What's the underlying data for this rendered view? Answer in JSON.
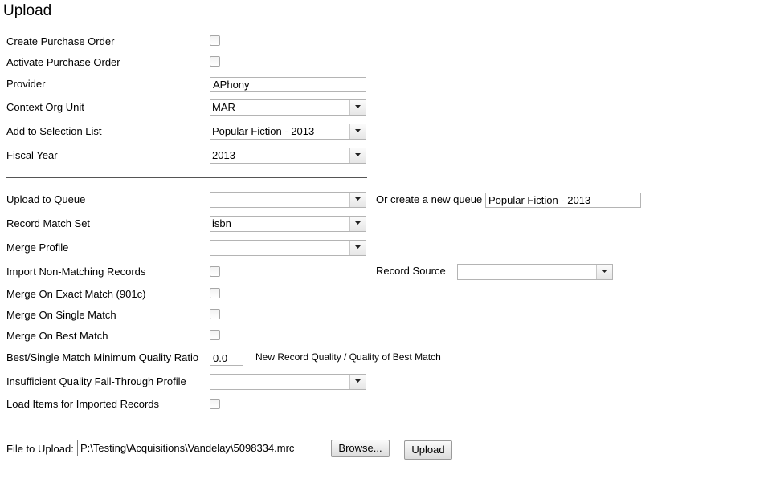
{
  "page": {
    "title": "Upload"
  },
  "po": {
    "create_label": "Create Purchase Order",
    "activate_label": "Activate Purchase Order",
    "provider_label": "Provider",
    "provider_value": "APhony",
    "context_label": "Context Org Unit",
    "context_value": "MAR",
    "selection_label": "Add to Selection List",
    "selection_value": "Popular Fiction - 2013",
    "fiscal_label": "Fiscal Year",
    "fiscal_value": "2013"
  },
  "queue": {
    "upload_label": "Upload to Queue",
    "upload_value": "",
    "new_queue_label": "Or create a new queue",
    "new_queue_value": "Popular Fiction - 2013",
    "match_set_label": "Record Match Set",
    "match_set_value": "isbn",
    "merge_profile_label": "Merge Profile",
    "merge_profile_value": "",
    "import_nonmatch_label": "Import Non-Matching Records",
    "record_source_label": "Record Source",
    "record_source_value": "",
    "exact_label": "Merge On Exact Match (901c)",
    "single_label": "Merge On Single Match",
    "best_label": "Merge On Best Match",
    "ratio_label": "Best/Single Match Minimum Quality Ratio",
    "ratio_value": "0.0",
    "ratio_hint": "New Record Quality / Quality of Best Match",
    "fallthrough_label": "Insufficient Quality Fall-Through Profile",
    "fallthrough_value": "",
    "load_items_label": "Load Items for Imported Records"
  },
  "file": {
    "label": "File to Upload:",
    "value": "P:\\Testing\\Acquisitions\\Vandelay\\5098334.mrc",
    "browse_label": "Browse...",
    "upload_label": "Upload"
  }
}
